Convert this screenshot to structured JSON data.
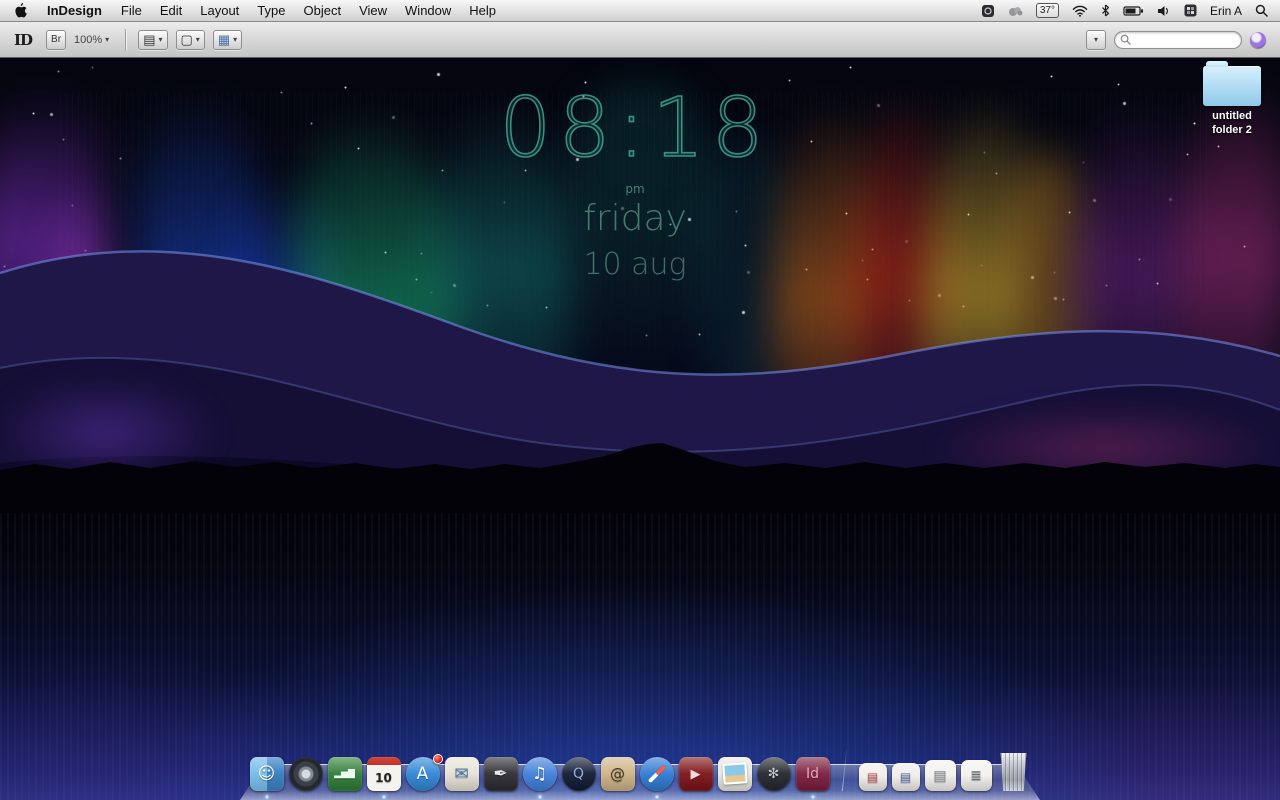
{
  "menu_bar": {
    "app_name": "InDesign",
    "menus": [
      "File",
      "Edit",
      "Layout",
      "Type",
      "Object",
      "View",
      "Window",
      "Help"
    ],
    "status": {
      "temperature_badge": "37°",
      "user_name": "Erin A"
    },
    "status_icons": [
      "menu-extra-dark",
      "menu-extra-gray",
      "temperature-badge",
      "wifi",
      "bluetooth",
      "battery",
      "volume",
      "input-source",
      "user-menu",
      "spotlight"
    ]
  },
  "toolbar": {
    "logo_text": "ID",
    "bridge_button": "Br",
    "zoom_level": "100%",
    "view_buttons": [
      {
        "name": "view-options",
        "glyph": "▤"
      },
      {
        "name": "screen-mode",
        "glyph": "▢"
      },
      {
        "name": "arrange-documents",
        "glyph": "▦"
      }
    ],
    "search": {
      "value": ""
    }
  },
  "icons": {
    "dropdown_arrow": "▾"
  },
  "desktop": {
    "clock": {
      "time": "08:18",
      "meridiem": "pm",
      "weekday": "friday",
      "date": "10 aug",
      "accent_color": "#49a18d"
    },
    "folder_label": "untitled folder 2",
    "folder_color": "#a8d8f0",
    "wallpaper_palette": [
      "#7a2fb8",
      "#1e58d8",
      "#17b584",
      "#e07714",
      "#d42315",
      "#e8b83a",
      "#b03a8a",
      "#1c2d74"
    ]
  },
  "dock": {
    "items": [
      {
        "name": "finder",
        "glyph": "☺",
        "color": "#4a94d6",
        "cls": "finder",
        "running": true
      },
      {
        "name": "launchpad",
        "glyph": "",
        "color": "#4a505a",
        "cls": "circle lp"
      },
      {
        "name": "numbers",
        "glyph": "▂▅▇",
        "color": "#2e7d36",
        "glyph_size": 9,
        "glyph_color": "#eafff0"
      },
      {
        "name": "calendar",
        "glyph": "10",
        "color": "#f4f3ee",
        "cls": "cal",
        "glyph_color": "#222222",
        "glyph_size": 12,
        "running": true
      },
      {
        "name": "app-store",
        "glyph": "A",
        "color": "#2f86d6",
        "cls": "circle",
        "badge": true
      },
      {
        "name": "mail",
        "glyph": "✉",
        "color": "#e7e2d6",
        "glyph_color": "#4a7ab2"
      },
      {
        "name": "textedit",
        "glyph": "✒",
        "color": "#2c2c31",
        "glyph_color": "#e8e8ee"
      },
      {
        "name": "itunes",
        "glyph": "♫",
        "color": "#3f7fd8",
        "cls": "circle",
        "running": true
      },
      {
        "name": "quicktime",
        "glyph": "Q",
        "color": "#111a33",
        "cls": "circle",
        "glyph_color": "#8fb2ee",
        "glyph_size": 14
      },
      {
        "name": "at-sign-app",
        "glyph": "@",
        "color": "#cdb387",
        "glyph_color": "#4a3b22",
        "glyph_size": 15
      },
      {
        "name": "safari",
        "glyph": "",
        "color": "#2e7ad2",
        "cls": "circle safari",
        "running": true
      },
      {
        "name": "dvd-player",
        "glyph": "▶",
        "color": "#7c1217",
        "glyph_color": "#f2d9da",
        "glyph_size": 13
      },
      {
        "name": "iphoto",
        "glyph": "",
        "color": "#e9e7e0",
        "cls": "photo"
      },
      {
        "name": "aperture",
        "glyph": "✻",
        "color": "#23262d",
        "cls": "circle",
        "glyph_color": "#c2c8d2",
        "glyph_size": 14
      },
      {
        "name": "indesign",
        "glyph": "Id",
        "color": "#7a1d3c",
        "glyph_color": "#f0aac2",
        "glyph_size": 14,
        "running": true
      },
      {
        "name": "separator",
        "type": "sep"
      },
      {
        "name": "stack-1",
        "glyph": "▤",
        "color": "#efece8",
        "size": 28,
        "glyph_color": "#c25555",
        "glyph_size": 12
      },
      {
        "name": "stack-2",
        "glyph": "▤",
        "color": "#efece8",
        "size": 28,
        "glyph_color": "#5577b2",
        "glyph_size": 12
      },
      {
        "name": "documents-stack",
        "glyph": "▤",
        "color": "#f2f1ee",
        "size": 31,
        "glyph_color": "#8a8f98",
        "glyph_size": 14
      },
      {
        "name": "downloads-stack",
        "glyph": "≣",
        "color": "#f2f1ee",
        "size": 31,
        "glyph_color": "#6a7078",
        "glyph_size": 14
      },
      {
        "name": "trash",
        "glyph": "",
        "color": "#c9cdd4",
        "cls": "trash",
        "size": 34,
        "h": 38
      }
    ]
  }
}
